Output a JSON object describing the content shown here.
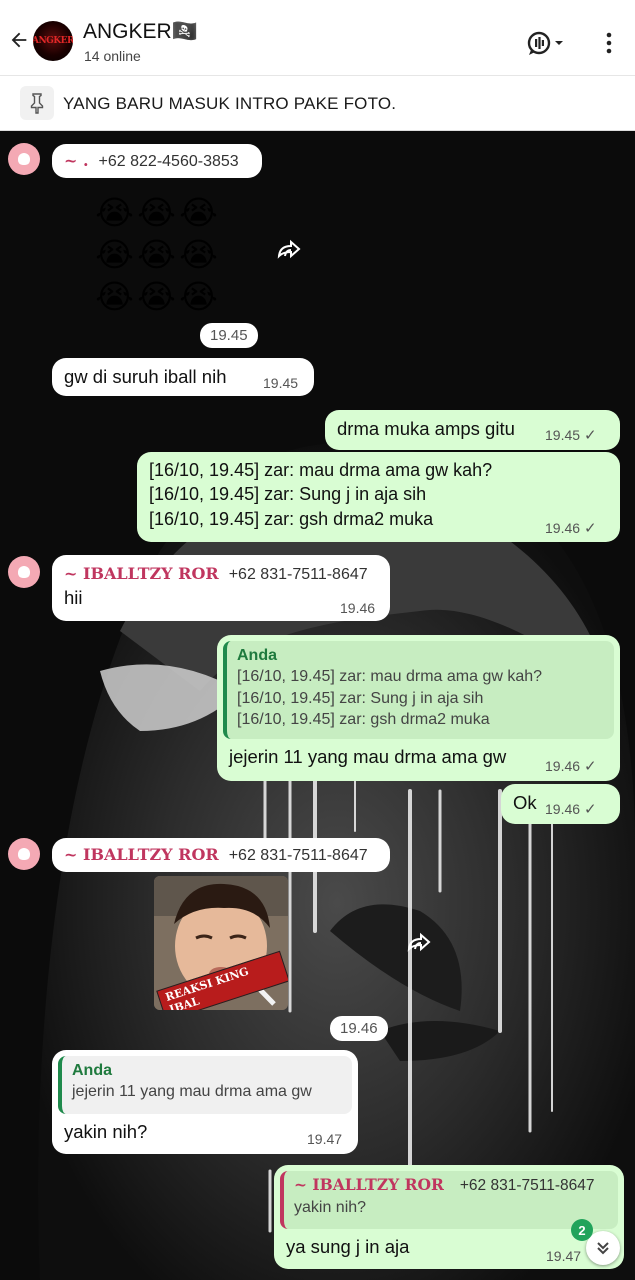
{
  "header": {
    "group_name": "ANGKER🏴‍☠️",
    "group_avatar_text": "ANGKER",
    "status": "14 online",
    "icons": [
      "back-arrow-icon",
      "voice-chat-icon",
      "more-vert-icon"
    ]
  },
  "pinned": {
    "text": "YANG BARU MASUK INTRO PAKE FOTO."
  },
  "messages": {
    "m1": {
      "sender_name": "~ .",
      "sender_phone": "+62 822-4560-3853",
      "emojis": [
        "😭",
        "😭",
        "😭",
        "😭",
        "😭",
        "😭",
        "😭",
        "😭",
        "😭"
      ],
      "time": "19.45"
    },
    "m2": {
      "text": "gw di suruh iball nih",
      "time": "19.45"
    },
    "m3": {
      "text": "drma muka amps gitu",
      "time": "19.45"
    },
    "m4": {
      "line1": "[16/10, 19.45] zar: mau drma ama gw kah?",
      "line2": "[16/10, 19.45] zar: Sung j in aja sih",
      "line3": "[16/10, 19.45] zar: gsh drma2 muka",
      "time": "19.46"
    },
    "m5": {
      "sender_name": "~ IBALLTZY ROR",
      "sender_phone": "+62 831-7511-8647",
      "text": "hii",
      "time": "19.46"
    },
    "m6": {
      "quote_author": "Anda",
      "quote_line1": "[16/10, 19.45] zar: mau drma ama gw kah?",
      "quote_line2": "[16/10, 19.45] zar: Sung j in aja sih",
      "quote_line3": "[16/10, 19.45] zar: gsh drma2 muka",
      "text": "jejerin 11 yang mau drma ama gw",
      "time": "19.46"
    },
    "m7": {
      "text": "Ok",
      "time": "19.46"
    },
    "m8": {
      "sender_name": "~ IBALLTZY ROR",
      "sender_phone": "+62 831-7511-8647",
      "sticker_caption": "REAKSI KING IBAL",
      "time": "19.46"
    },
    "m9": {
      "quote_author": "Anda",
      "quote_text": "jejerin 11 yang mau drma ama gw",
      "text": "yakin nih?",
      "time": "19.47"
    },
    "m10": {
      "quote_author": "~ IBALLTZY ROR",
      "quote_phone": "+62 831-7511-8647",
      "quote_text": "yakin nih?",
      "text": "ya sung j in aja",
      "time": "19.47"
    }
  },
  "unread_count": "2"
}
